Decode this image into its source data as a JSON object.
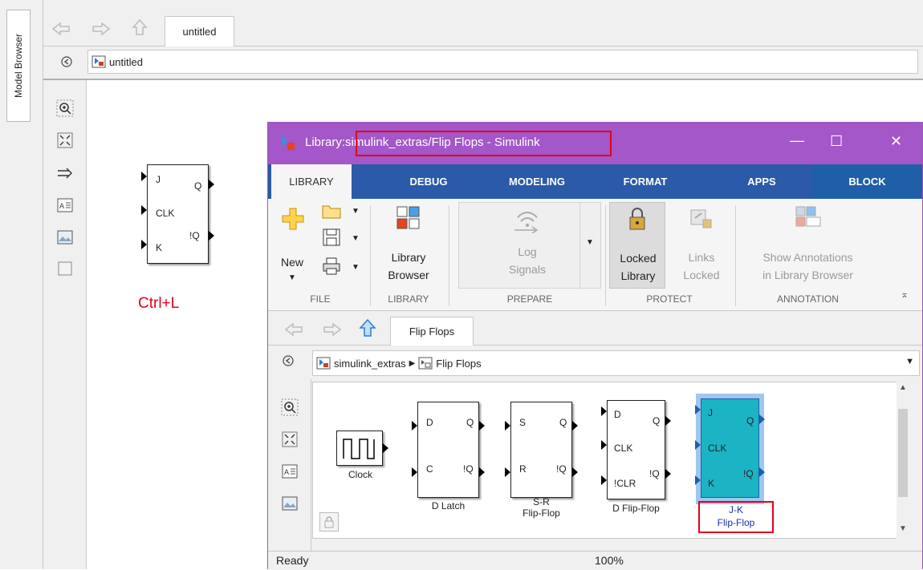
{
  "outer": {
    "model_browser_label": "Model Browser",
    "tab_label": "untitled",
    "address": "untitled",
    "canvas_block": {
      "in_j": "J",
      "in_clk": "CLK",
      "in_k": "K",
      "out_q": "Q",
      "out_nq": "!Q"
    },
    "shortcut_text": "Ctrl+L"
  },
  "library": {
    "title_prefix": "Library:",
    "title_path": "simulink_extras/Flip Flops - Simulink",
    "window_controls": {
      "minimize": "—",
      "maximize": "☐",
      "close": "✕"
    },
    "ribbon_tabs": [
      "LIBRARY",
      "DEBUG",
      "MODELING",
      "FORMAT",
      "APPS",
      "BLOCK"
    ],
    "ribbon": {
      "new_label": "New",
      "library_browser_label": "Library\nBrowser",
      "log_signals_label": "Log\nSignals",
      "locked_library_label": "Locked\nLibrary",
      "links_locked_label": "Links\nLocked",
      "show_annotations_label": "Show Annotations\nin Library Browser",
      "sections": [
        "FILE",
        "LIBRARY",
        "PREPARE",
        "PROTECT",
        "ANNOTATION"
      ]
    },
    "nav_tab": "Flip Flops",
    "address_parts": [
      "simulink_extras",
      "Flip Flops"
    ],
    "blocks": {
      "clock": "Clock",
      "d_latch": {
        "name": "D Latch",
        "in1": "D",
        "in2": "C",
        "out1": "Q",
        "out2": "!Q"
      },
      "sr": {
        "name": "S-R\nFlip-Flop",
        "in1": "S",
        "in2": "R",
        "out1": "Q",
        "out2": "!Q"
      },
      "dff": {
        "name": "D Flip-Flop",
        "in1": "D",
        "in2": "CLK",
        "in3": "!CLR",
        "out1": "Q",
        "out2": "!Q"
      },
      "jk": {
        "name": "J-K\nFlip-Flop",
        "in1": "J",
        "in2": "CLK",
        "in3": "K",
        "out1": "Q",
        "out2": "!Q"
      }
    },
    "status": {
      "state": "Ready",
      "zoom": "100%"
    }
  },
  "colors": {
    "title_bar": "#a357c8",
    "ribbon_tabs": "#2b5aa8",
    "block_tab": "#1f5fa8",
    "highlight": "#e3001b",
    "jk_fill": "#1ab4c4"
  }
}
